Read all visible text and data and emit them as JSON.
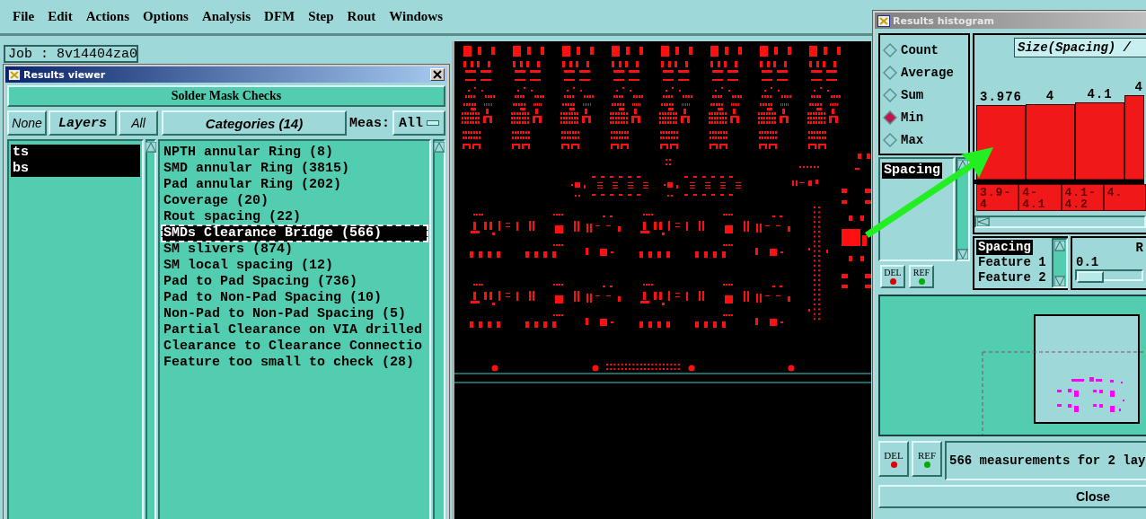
{
  "menu_bar": {
    "items": [
      "File",
      "Edit",
      "Actions",
      "Options",
      "Analysis",
      "DFM",
      "Step",
      "Rout",
      "Windows"
    ]
  },
  "job_label": "Job : 8v14404za0",
  "results_viewer": {
    "title": "Results viewer",
    "header_button": "Solder Mask Checks",
    "layer_buttons": [
      {
        "label": "None",
        "kind": "button"
      },
      {
        "label": "Layers",
        "kind": "heading"
      },
      {
        "label": "All",
        "kind": "button"
      }
    ],
    "categories_button": "Categories (14)",
    "meas_label": "Meas:",
    "meas_value": "All",
    "layers": [
      {
        "name": "ts",
        "selected": true
      },
      {
        "name": "bs",
        "selected": true
      }
    ],
    "categories": [
      {
        "label": "NPTH annular Ring (8)",
        "selected": false
      },
      {
        "label": "SMD annular Ring (3815)",
        "selected": false
      },
      {
        "label": "Pad annular Ring (202)",
        "selected": false
      },
      {
        "label": "Coverage (20)",
        "selected": false
      },
      {
        "label": "Rout spacing (22)",
        "selected": false
      },
      {
        "label": "SMDs Clearance Bridge (566)",
        "selected": true
      },
      {
        "label": "SM slivers (874)",
        "selected": false
      },
      {
        "label": "SM local spacing (12)",
        "selected": false
      },
      {
        "label": "Pad to Pad Spacing (736)",
        "selected": false
      },
      {
        "label": "Pad to Non-Pad Spacing (10)",
        "selected": false
      },
      {
        "label": "Non-Pad to Non-Pad Spacing (5)",
        "selected": false
      },
      {
        "label": "Partial Clearance on VIA drilled",
        "selected": false
      },
      {
        "label": "Clearance to Clearance Connectio",
        "selected": false
      },
      {
        "label": "Feature too small to check (28)",
        "selected": false
      }
    ]
  },
  "results_histogram": {
    "title": "Results histogram",
    "modes": [
      {
        "label": "Count",
        "selected": false
      },
      {
        "label": "Average",
        "selected": false
      },
      {
        "label": "Sum",
        "selected": false
      },
      {
        "label": "Min",
        "selected": true
      },
      {
        "label": "Max",
        "selected": false
      }
    ],
    "measures": [
      {
        "label": "Spacing",
        "selected": true
      }
    ],
    "markers": [
      {
        "label": "DEL",
        "color": "#e00000"
      },
      {
        "label": "REF",
        "color": "#00b000"
      }
    ],
    "histogram": {
      "title": "Size(Spacing) /",
      "bar_labels": [
        "3.976",
        "4",
        "4.1",
        "4"
      ],
      "bin_labels": [
        "3.9-4",
        "4-4.1",
        "4.1-4.2",
        "4."
      ]
    },
    "fields": [
      {
        "label": "Spacing",
        "selected": true
      },
      {
        "label": "Feature 1",
        "selected": false
      },
      {
        "label": "Feature 2",
        "selected": false
      }
    ],
    "range_label": "R",
    "range_value": "0.1",
    "range_slider": {
      "level": 0
    },
    "preview_markers": [
      {
        "label": "DEL",
        "color": "#e00000"
      },
      {
        "label": "REF",
        "color": "#00b000"
      }
    ],
    "status": "566 measurements for 2 lay",
    "close_button": "Close"
  }
}
